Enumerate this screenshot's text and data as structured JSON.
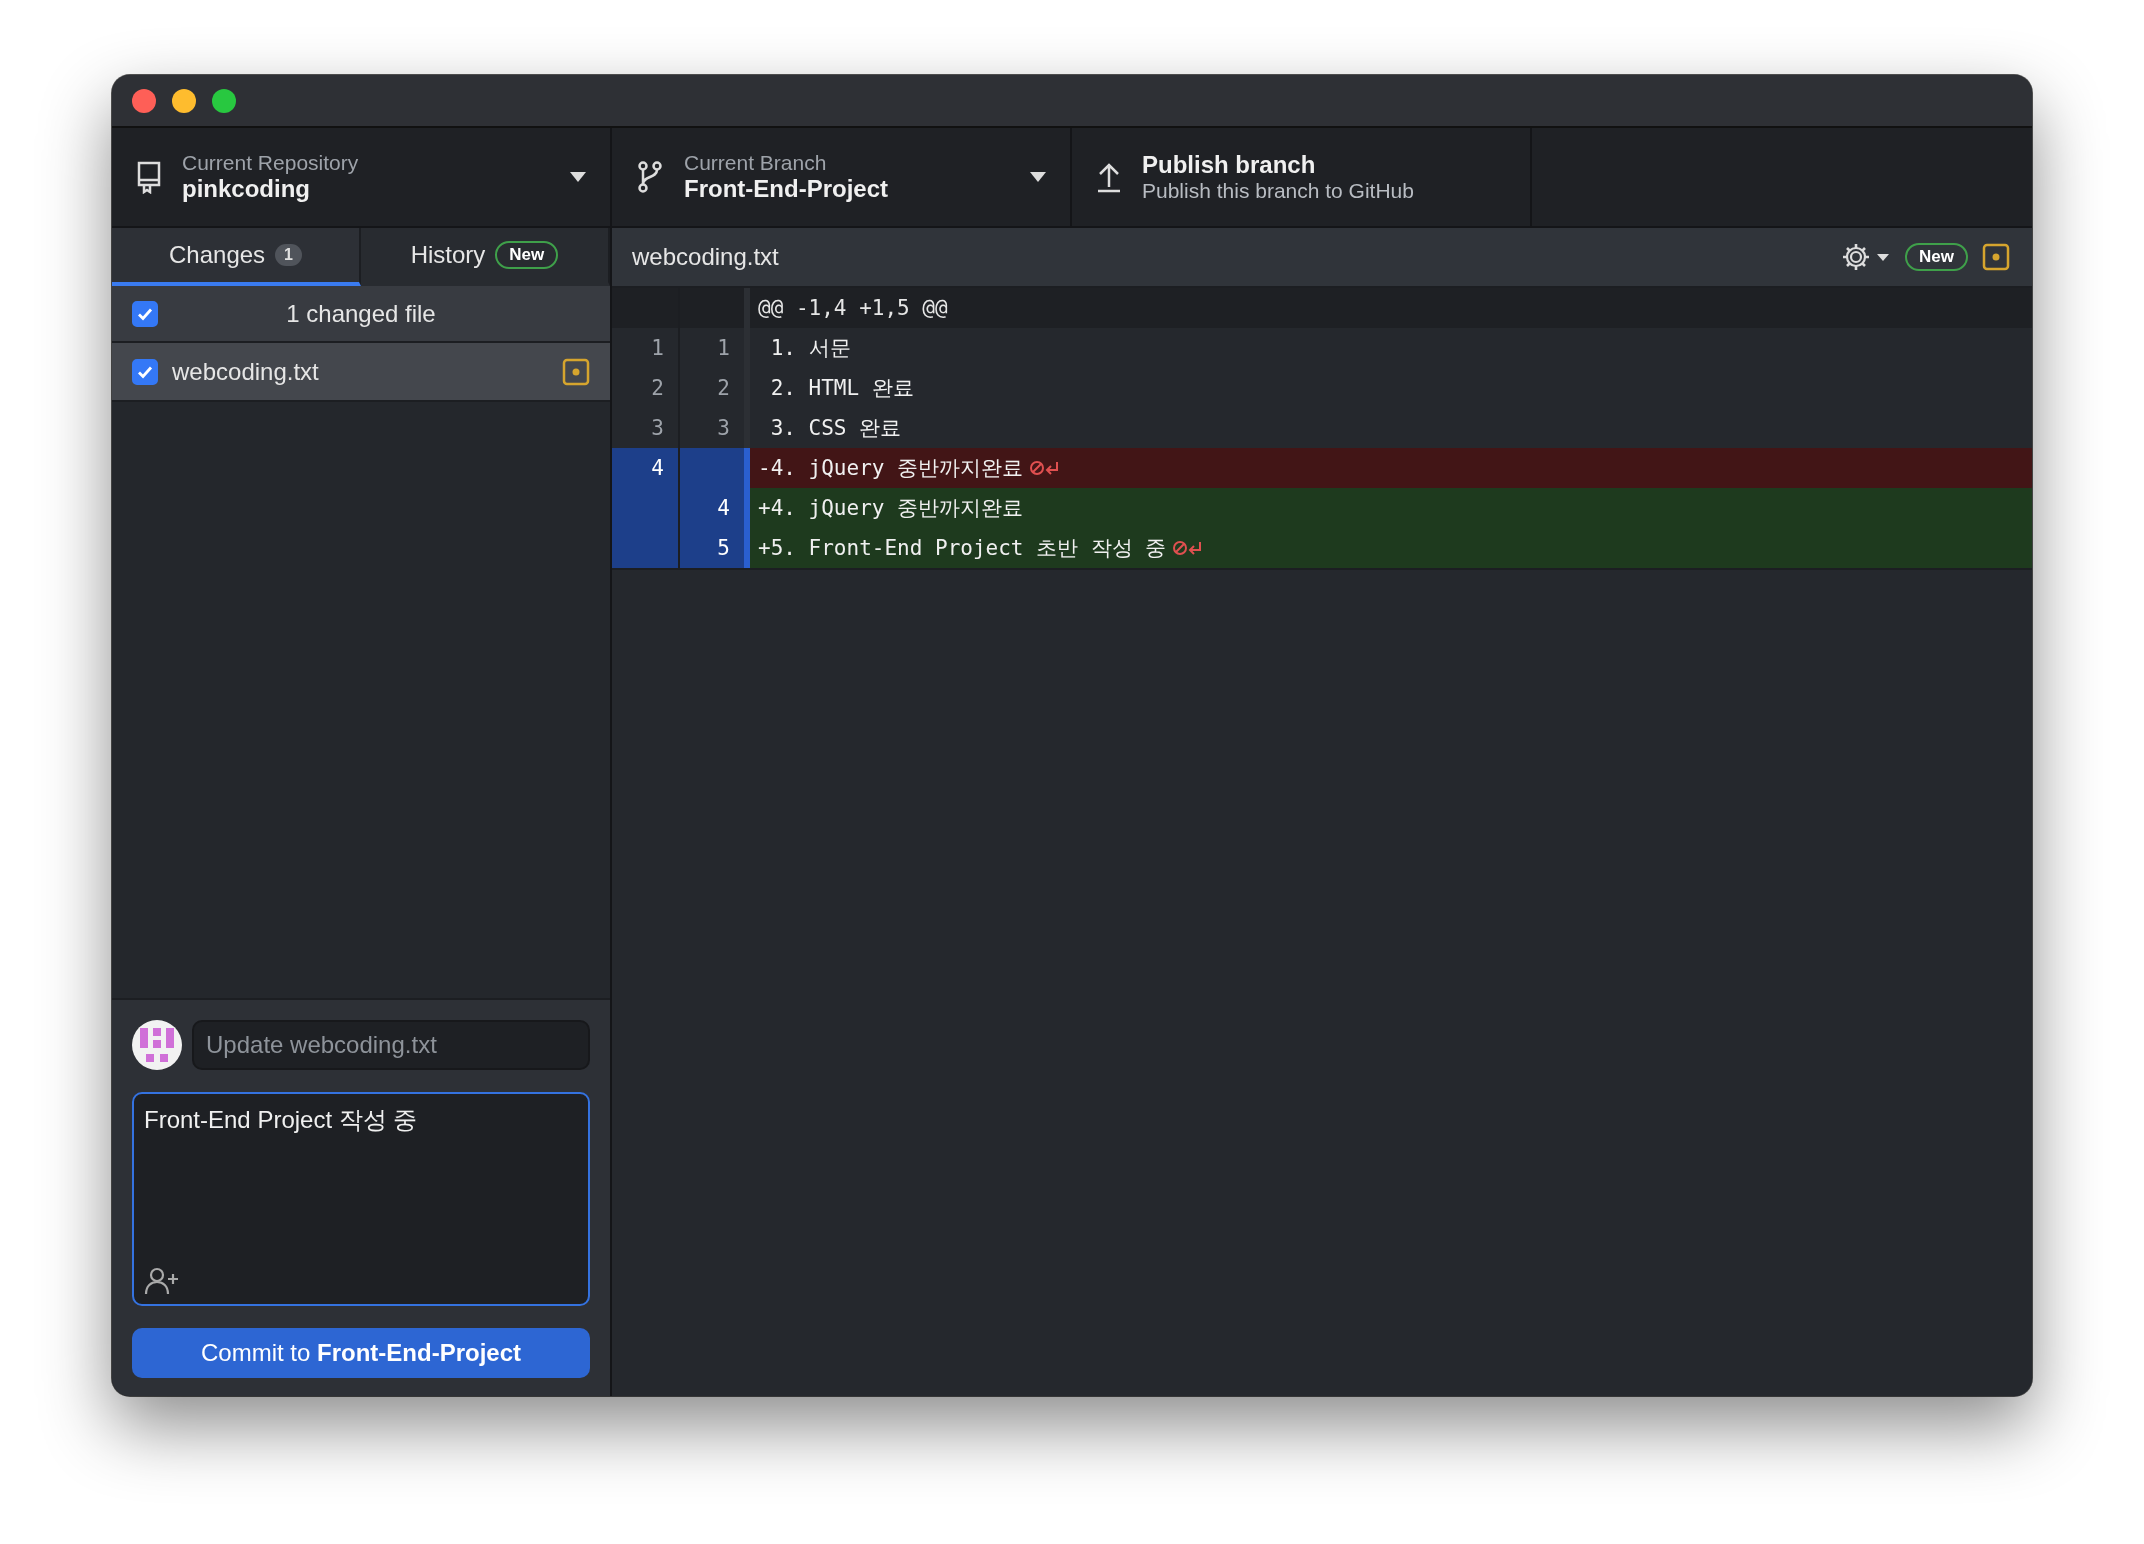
{
  "toolbar": {
    "repository": {
      "label": "Current Repository",
      "value": "pinkcoding"
    },
    "branch": {
      "label": "Current Branch",
      "value": "Front-End-Project"
    },
    "publish": {
      "title": "Publish branch",
      "subtitle": "Publish this branch to GitHub"
    }
  },
  "tabs": [
    {
      "label": "Changes",
      "count": "1",
      "selected": true
    },
    {
      "label": "History",
      "badge": "New",
      "selected": false
    }
  ],
  "changes": {
    "header": {
      "label": "1 changed file",
      "checked": true
    },
    "files": [
      {
        "name": "webcoding.txt",
        "checked": true,
        "selected": true,
        "modified": true
      }
    ]
  },
  "commit": {
    "summary_placeholder": "Update webcoding.txt",
    "description": "Front-End Project 작성 중",
    "button": "Commit to **Front-End-Project**"
  },
  "diff": {
    "file": "webcoding.txt",
    "badge": "New",
    "modified": true,
    "hunk_header": "@@ -1,4 +1,5 @@",
    "lines": [
      {
        "kind": "context",
        "old": "1",
        "new": "1",
        "text": " 1. 서문",
        "no_newline": false
      },
      {
        "kind": "context",
        "old": "2",
        "new": "2",
        "text": " 2. HTML 완료",
        "no_newline": false
      },
      {
        "kind": "context",
        "old": "3",
        "new": "3",
        "text": " 3. CSS 완료",
        "no_newline": false
      },
      {
        "kind": "deleted",
        "old": "4",
        "text": "-4. jQuery 중반까지완료",
        "no_newline": true
      },
      {
        "kind": "added",
        "new": "4",
        "text": "+4. jQuery 중반까지완료",
        "no_newline": false
      },
      {
        "kind": "added",
        "new": "5",
        "text": "+5. Front-End Project 초반 작성 중",
        "no_newline": true
      }
    ]
  }
}
